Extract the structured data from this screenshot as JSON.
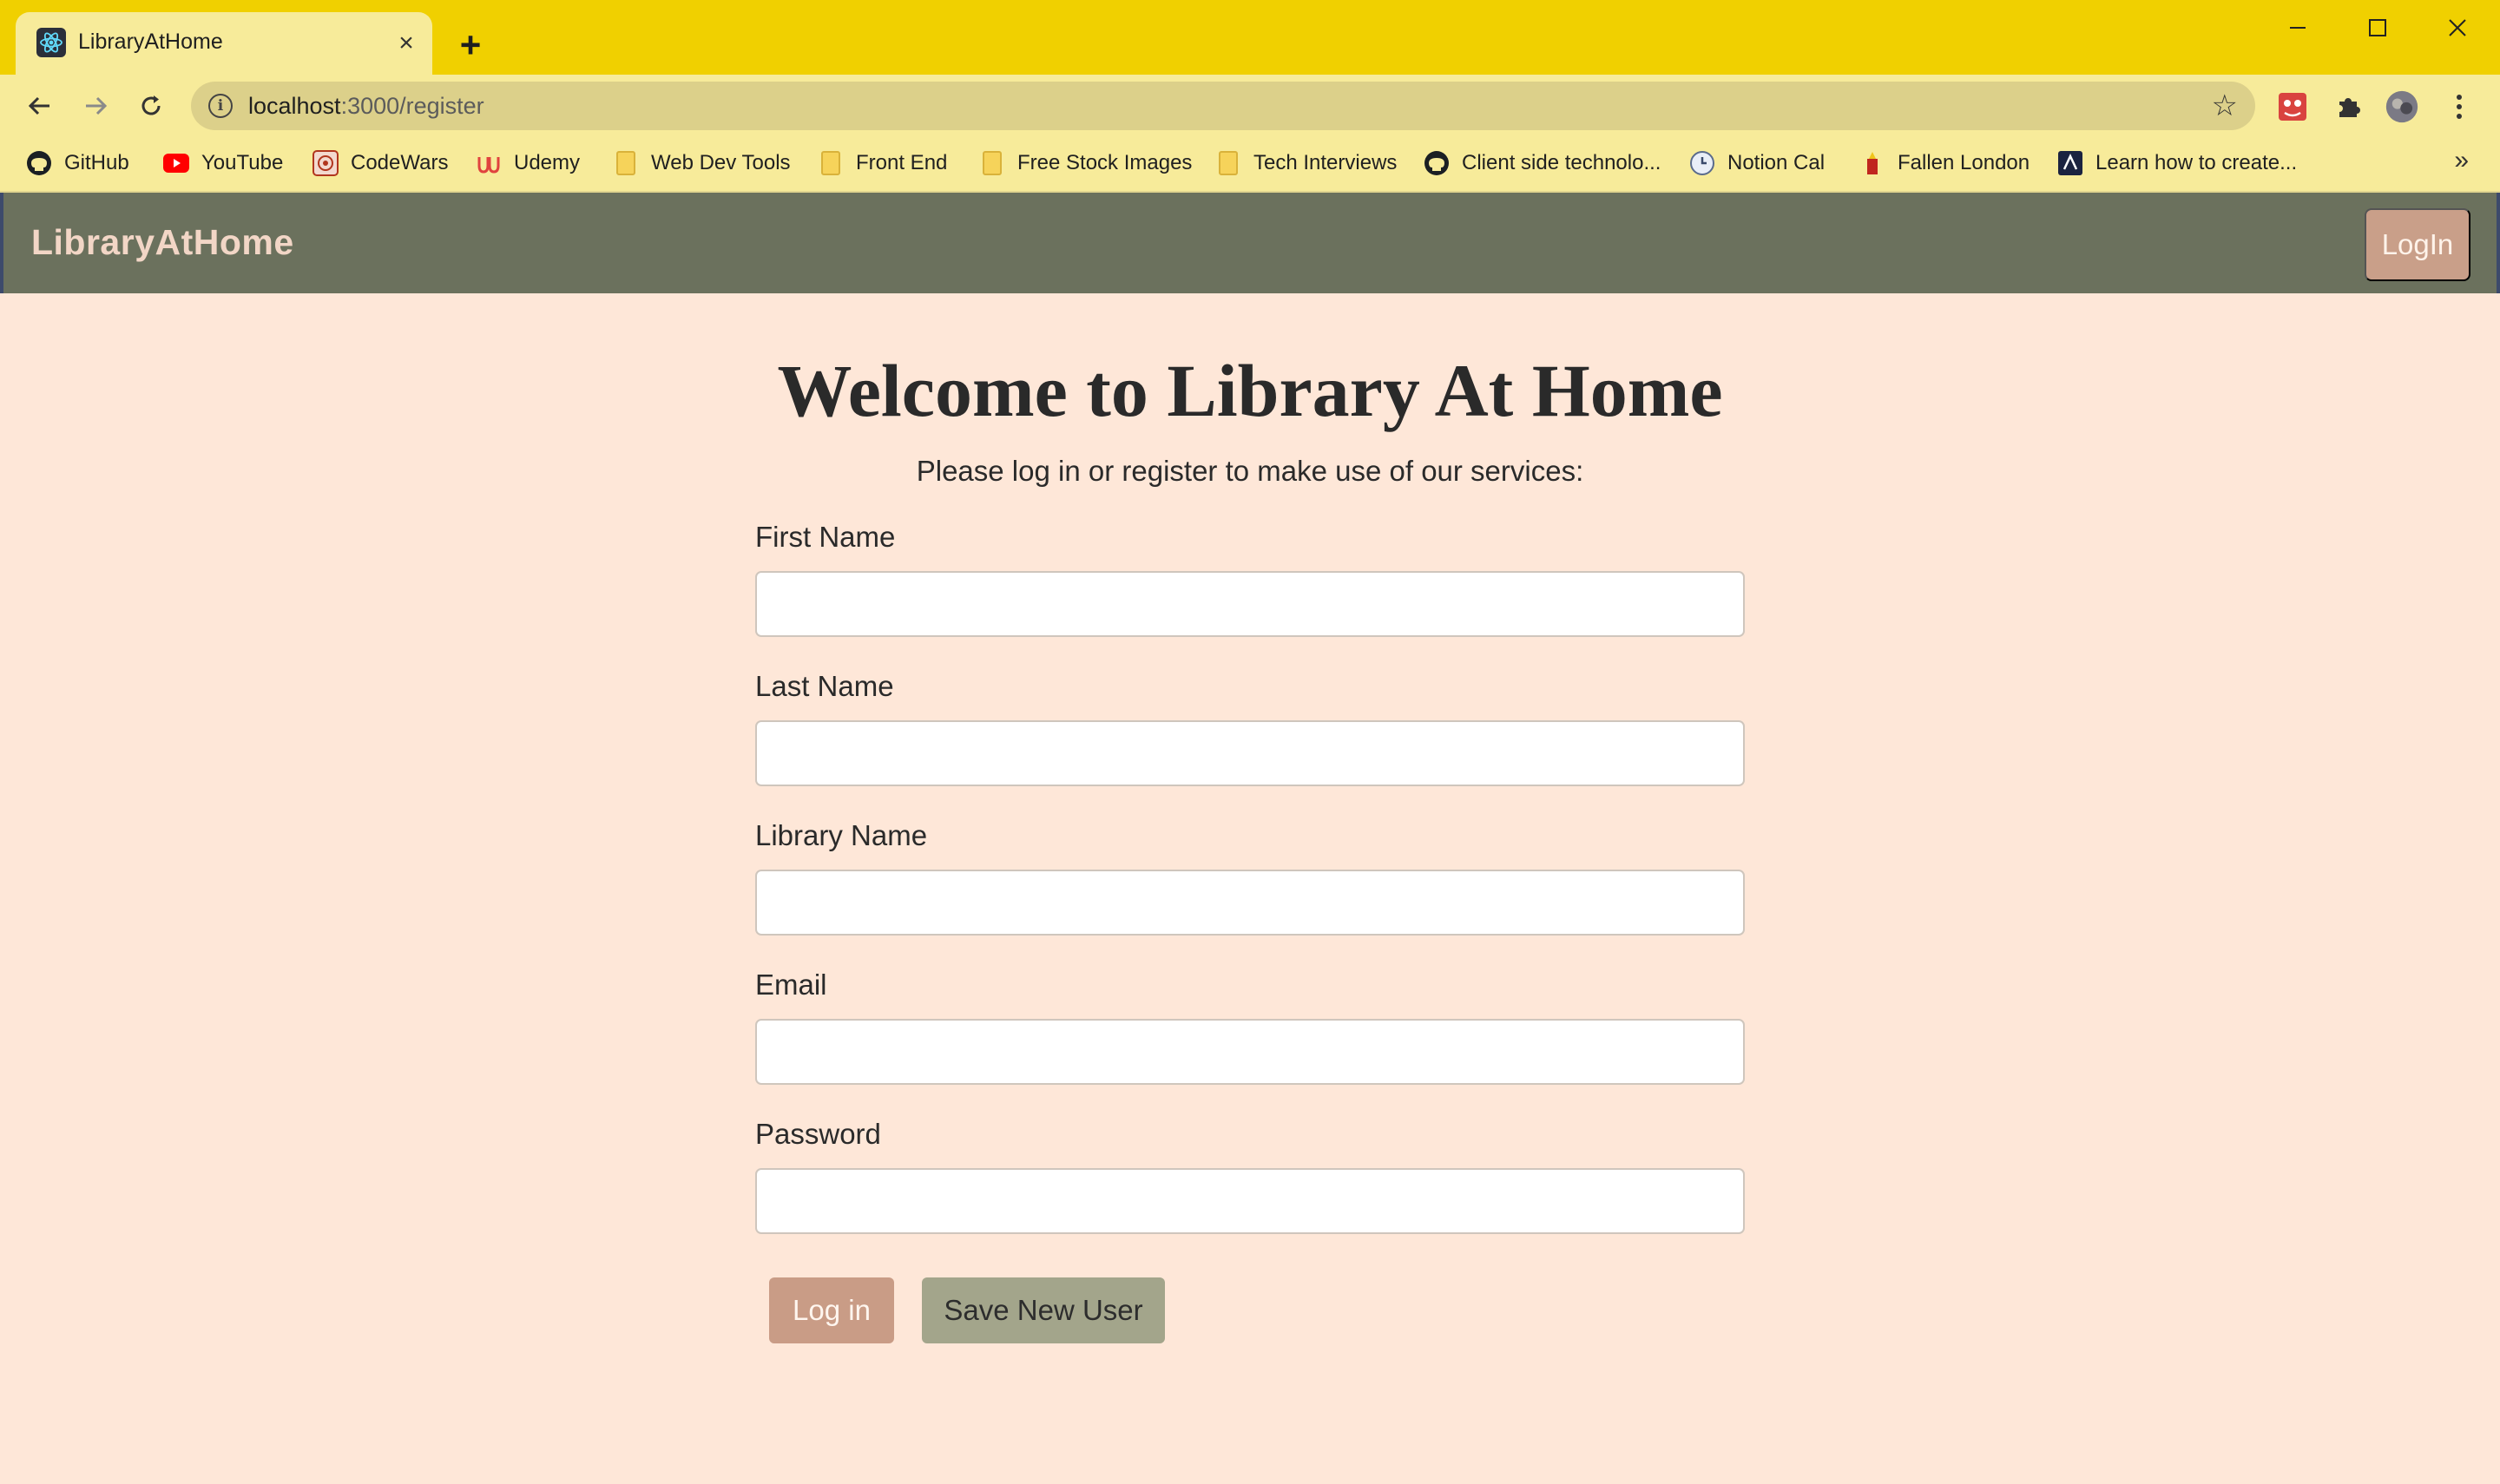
{
  "browser": {
    "tab": {
      "title": "LibraryAtHome",
      "close_glyph": "×"
    },
    "new_tab_glyph": "+",
    "window_controls": {
      "minimize": "—",
      "maximize": "☐",
      "close": "✕"
    },
    "nav": {
      "back": "←",
      "forward": "→",
      "reload": "↻"
    },
    "address": {
      "host": "localhost",
      "path": ":3000/register"
    },
    "bookmarks": [
      {
        "label": "GitHub",
        "icon": "github-icon"
      },
      {
        "label": "YouTube",
        "icon": "youtube-icon"
      },
      {
        "label": "CodeWars",
        "icon": "codewars-icon"
      },
      {
        "label": "Udemy",
        "icon": "udemy-icon"
      },
      {
        "label": "Web Dev Tools",
        "icon": "folder-icon"
      },
      {
        "label": "Front End",
        "icon": "folder-icon"
      },
      {
        "label": "Free Stock Images",
        "icon": "folder-icon"
      },
      {
        "label": "Tech Interviews",
        "icon": "folder-icon"
      },
      {
        "label": "Client side technolo...",
        "icon": "github-icon"
      },
      {
        "label": "Notion Cal",
        "icon": "clock-icon"
      },
      {
        "label": "Fallen London",
        "icon": "fallen-london-icon"
      },
      {
        "label": "Learn how to create...",
        "icon": "site-icon"
      }
    ],
    "bookmarks_more": "»"
  },
  "app": {
    "brand": "LibraryAtHome",
    "nav_login": "LogIn",
    "welcome_title": "Welcome to Library At Home",
    "subtitle": "Please log in or register to make use of our services:",
    "fields": {
      "first_name": {
        "label": "First Name",
        "value": ""
      },
      "last_name": {
        "label": "Last Name",
        "value": ""
      },
      "library_name": {
        "label": "Library Name",
        "value": ""
      },
      "email": {
        "label": "Email",
        "value": ""
      },
      "password": {
        "label": "Password",
        "value": ""
      }
    },
    "buttons": {
      "login": "Log in",
      "save": "Save New User"
    }
  },
  "colors": {
    "tabstrip": "#f0d000",
    "toolbar": "#f7eb9a",
    "navbar": "#6b715d",
    "page_bg": "#fee7d8",
    "login_button": "#c99c86",
    "save_button": "#a3a58b"
  }
}
